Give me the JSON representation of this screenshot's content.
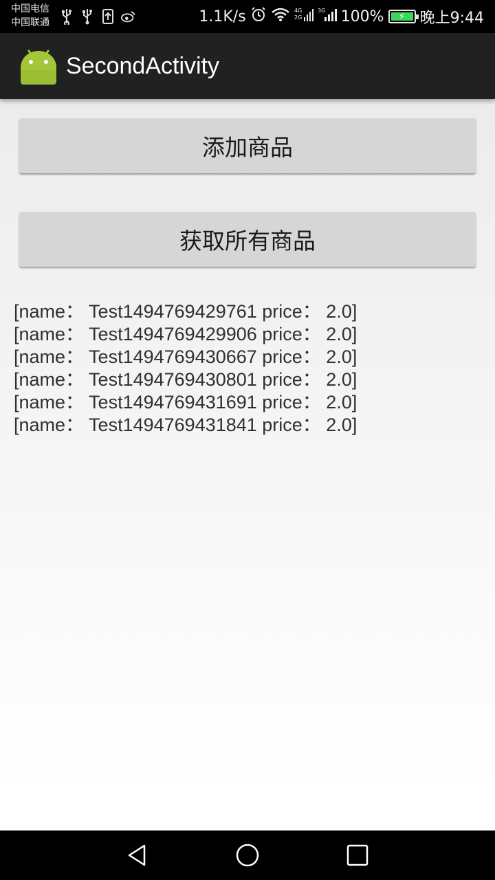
{
  "status_bar": {
    "carrier_1": "中国电信",
    "carrier_2": "中国联通",
    "left_icons": [
      "usb-icon",
      "usb-icon",
      "upload-icon",
      "weibo-icon"
    ],
    "net_speed": "1.1K/s",
    "battery": "100%",
    "time": "晚上9:44",
    "battery_color": "#3cd65c"
  },
  "action_bar": {
    "title": "SecondActivity",
    "icon": "android-icon",
    "icon_color": "#a4c639"
  },
  "buttons": {
    "add_product": "添加商品",
    "get_all_products": "获取所有商品"
  },
  "products": [
    "[name： Test1494769429761 price： 2.0]",
    "[name： Test1494769429906 price： 2.0]",
    "[name： Test1494769430667 price： 2.0]",
    "[name： Test1494769430801 price： 2.0]",
    "[name： Test1494769431691 price： 2.0]",
    "[name： Test1494769431841 price： 2.0]"
  ],
  "nav_bar": {
    "back": "back-icon",
    "home": "home-icon",
    "recent": "recent-apps-icon"
  }
}
